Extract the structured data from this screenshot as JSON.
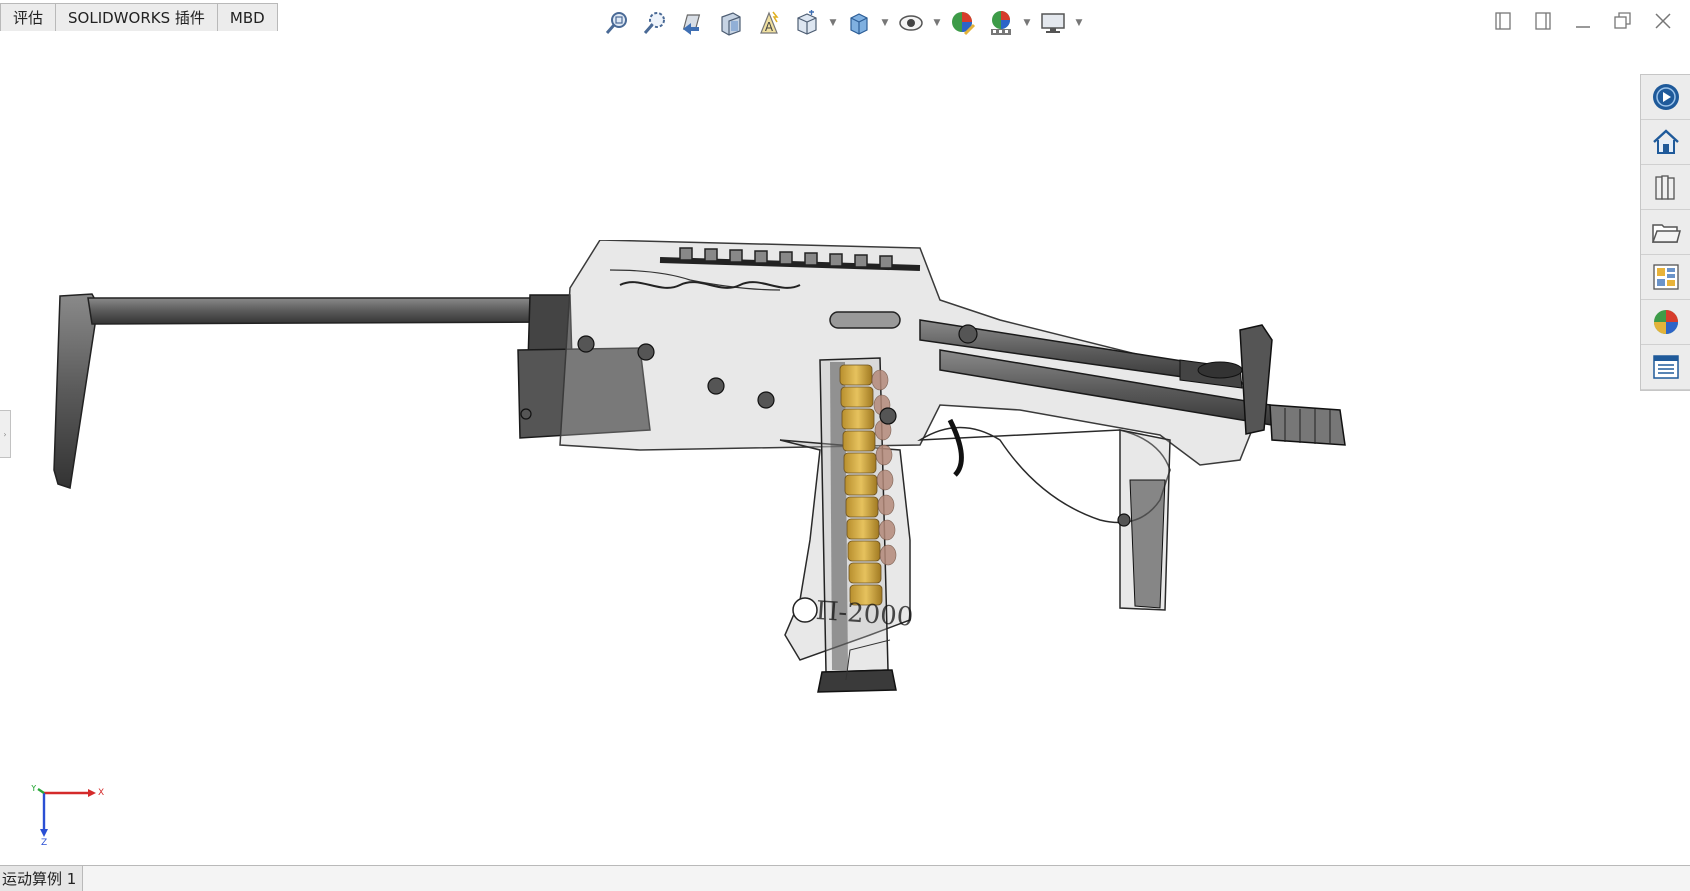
{
  "tabs": [
    {
      "label": "评估"
    },
    {
      "label": "SOLIDWORKS 插件"
    },
    {
      "label": "MBD"
    }
  ],
  "hud_toolbar": {
    "icons": [
      "zoom-to-fit-icon",
      "zoom-to-area-icon",
      "previous-view-icon",
      "section-view-icon",
      "dynamic-annotation-views-icon",
      "view-orientation-icon",
      "display-style-icon",
      "hide-show-items-icon",
      "edit-appearance-icon",
      "apply-scene-icon",
      "view-settings-icon"
    ]
  },
  "task_pane": {
    "icons": [
      "solidworks-resources-icon",
      "home-icon",
      "design-library-icon",
      "file-explorer-icon",
      "view-palette-icon",
      "appearances-scenes-icon",
      "custom-properties-icon"
    ]
  },
  "model": {
    "label": "П-2000",
    "colors": {
      "metal": "#6b6b6b",
      "metal_dark": "#3a3a3a",
      "transparent_body": "#bdbdbd",
      "cartridge": "#c9a440",
      "bullet": "#b48a7a"
    }
  },
  "triad": {
    "x_label": "X",
    "y_label": "Y",
    "z_label": "Z",
    "colors": {
      "x": "#d42a2a",
      "y": "#2aa83a",
      "z": "#2a4fd4"
    }
  },
  "bottom_bar": {
    "tab_label": "运动算例 1"
  }
}
